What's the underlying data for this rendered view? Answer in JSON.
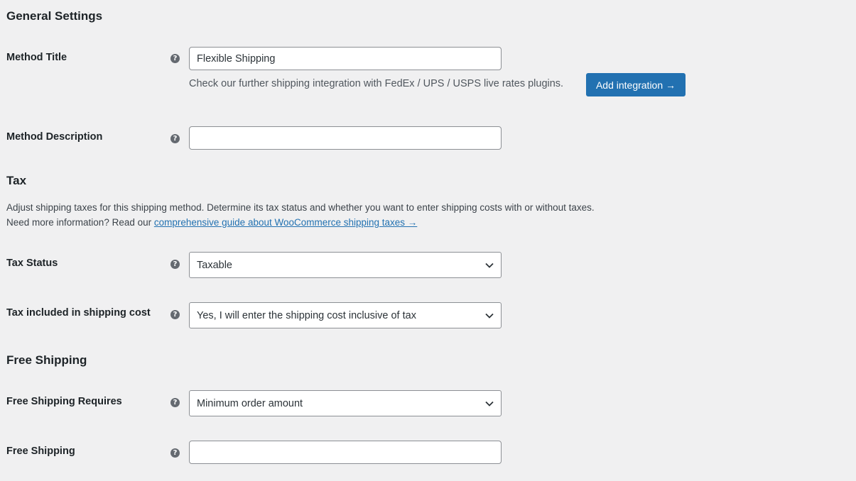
{
  "general": {
    "title": "General Settings",
    "method_title_label": "Method Title",
    "method_title_value": "Flexible Shipping",
    "integration_note": "Check our further shipping integration with FedEx / UPS / USPS live rates plugins.",
    "integration_button": "Add integration →",
    "method_description_label": "Method Description",
    "method_description_value": ""
  },
  "tax": {
    "title": "Tax",
    "desc_line1": "Adjust shipping taxes for this shipping method. Determine its tax status and whether you want to enter shipping costs with or without taxes.",
    "desc_line2_prefix": "Need more information? Read our ",
    "desc_link": "comprehensive guide about WooCommerce shipping taxes →",
    "status_label": "Tax Status",
    "status_value": "Taxable",
    "included_label": "Tax included in shipping cost",
    "included_value": "Yes, I will enter the shipping cost inclusive of tax"
  },
  "free_shipping": {
    "title": "Free Shipping",
    "requires_label": "Free Shipping Requires",
    "requires_value": "Minimum order amount",
    "amount_label": "Free Shipping",
    "amount_value": ""
  },
  "icons": {
    "help": "?",
    "chevron": "chevron-down-icon"
  },
  "colors": {
    "background": "#f0f0f1",
    "primary": "#2271b1",
    "help_icon": "#646970"
  }
}
